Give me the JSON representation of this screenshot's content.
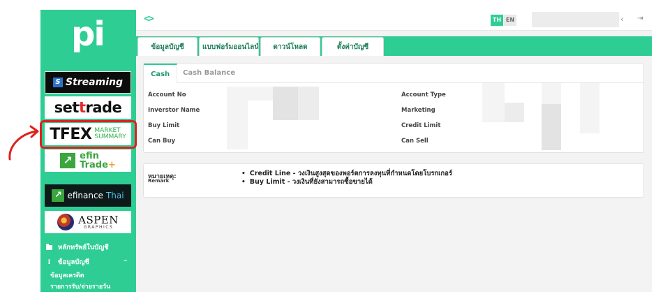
{
  "brand": {
    "logo_text": "pi"
  },
  "sidebar": {
    "links": [
      {
        "id": "streaming",
        "text": "Streaming",
        "mark": "S"
      },
      {
        "id": "settrade",
        "text_a": "set",
        "text_b": "t",
        "text_c": "rade"
      },
      {
        "id": "tfex",
        "big": "TFEX",
        "small_1": "MARKET",
        "small_2": "SUMMARY"
      },
      {
        "id": "efin",
        "mark": "↗",
        "line_1": "efin",
        "line_2": "Trade",
        "plus": "+"
      },
      {
        "id": "efinancethai",
        "mark": "↗",
        "text_a": "efinance",
        "text_b": "Thai"
      },
      {
        "id": "aspen",
        "line_1": "ASPEN",
        "line_2": "GRAPHICS"
      }
    ],
    "menu": [
      {
        "id": "securities",
        "label": "หลักทรัพย์ในบัญชี",
        "icon": "folder-icon"
      },
      {
        "id": "account-info",
        "label": "ข้อมูลบัญชี",
        "icon": "info-icon",
        "chevron": "⌄"
      }
    ],
    "sub_items": [
      {
        "label": "ข้อมูลเครดิต"
      },
      {
        "label": "รายการรับ/จ่ายรายวัน"
      }
    ]
  },
  "topbar": {
    "toggle_glyph": "<>",
    "lang_th": "TH",
    "lang_en": "EN",
    "prev_glyph": "‹",
    "logout_glyph": "⇥"
  },
  "menu_tabs": [
    {
      "label": "ข้อมูลบัญชี"
    },
    {
      "label": "แบบฟอร์มออนไลน์"
    },
    {
      "label": "ดาวน์โหลด"
    },
    {
      "label": "ตั้งค่าบัญชี"
    }
  ],
  "card": {
    "tabs": [
      {
        "label": "Cash",
        "active": true
      },
      {
        "label": "Cash Balance",
        "active": false
      }
    ],
    "fields_left": [
      {
        "label": "Account No"
      },
      {
        "label": "Inverstor Name"
      },
      {
        "label": "Buy Limit"
      },
      {
        "label": "Can Buy"
      }
    ],
    "fields_right": [
      {
        "label": "Account Type"
      },
      {
        "label": "Marketing"
      },
      {
        "label": "Credit Limit"
      },
      {
        "label": "Can Sell"
      }
    ]
  },
  "remark": {
    "title": "หมายเหตุ:",
    "subtitle": "Remark",
    "items": [
      {
        "text": "Credit Line - วงเงินสูงสุดของพอร์ตการลงทุนที่กำหนดโดยโบรกเกอร์"
      },
      {
        "text": "Buy Limit - วงเงินที่ยังสามารถซื้อขายได้"
      }
    ],
    "bullet": "•"
  },
  "colors": {
    "brand_green": "#2ecd94",
    "highlight_red": "#e0201c",
    "active_tab_text": "#1d9b6c"
  }
}
